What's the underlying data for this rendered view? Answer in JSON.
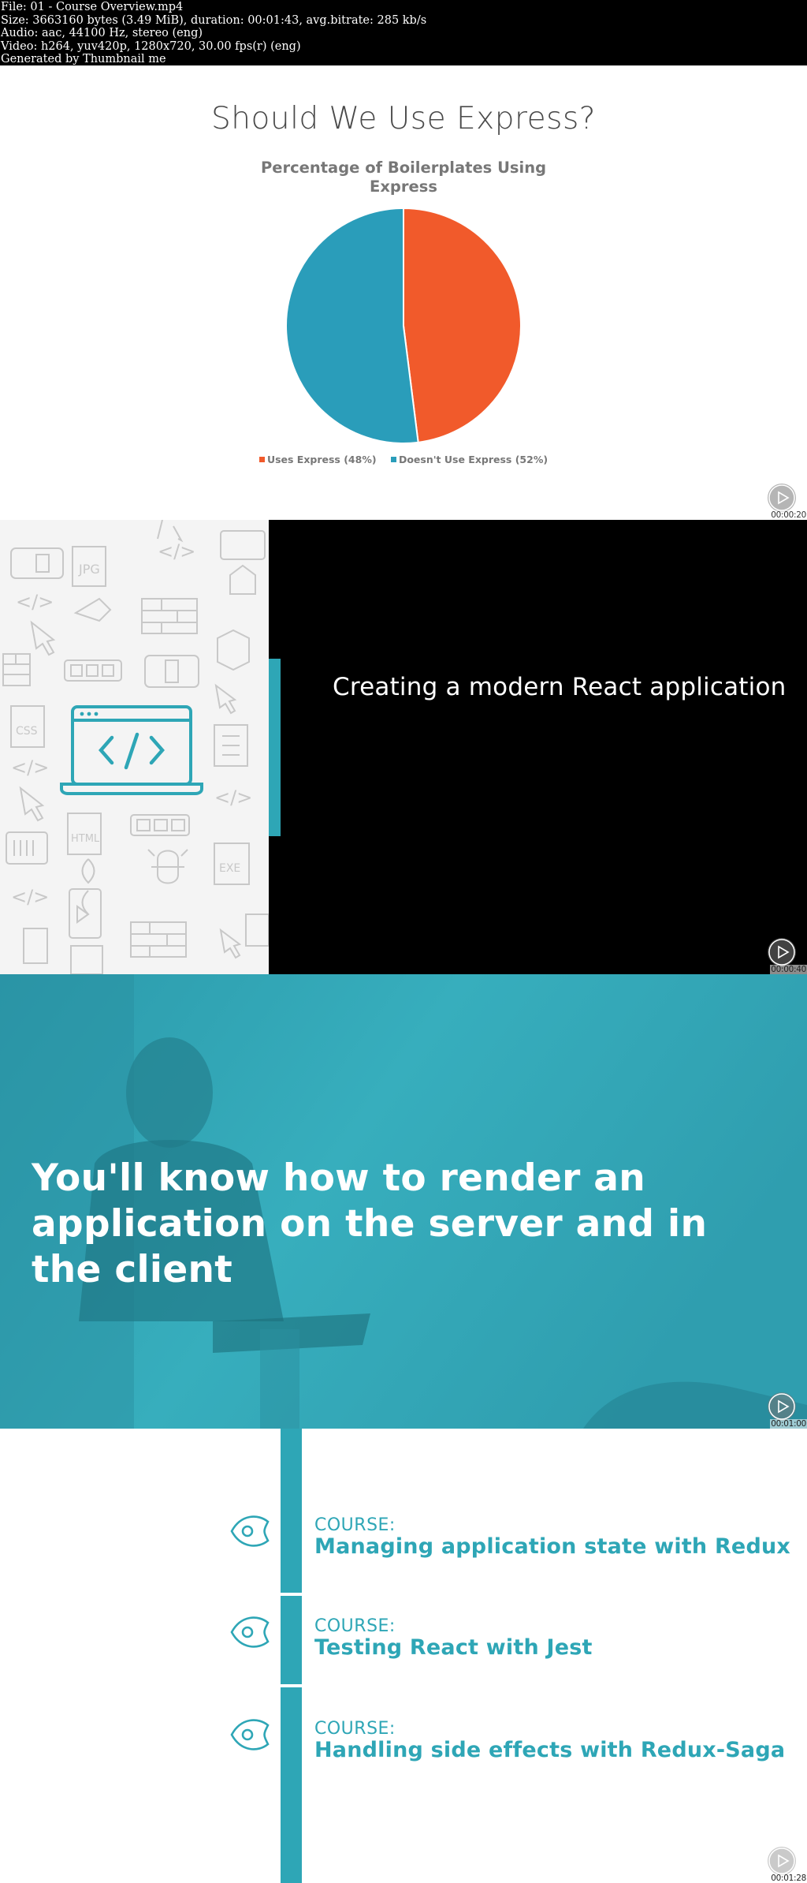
{
  "header": {
    "lines": [
      "File: 01 - Course Overview.mp4",
      "Size: 3663160 bytes (3.49 MiB), duration: 00:01:43, avg.bitrate: 285 kb/s",
      "Audio: aac, 44100 Hz, stereo (eng)",
      "Video: h264, yuv420p, 1280x720, 30.00 fps(r) (eng)",
      "Generated by Thumbnail me"
    ]
  },
  "frames": [
    {
      "timestamp": "00:00:20",
      "title": "Should We Use Express?",
      "chart_title": "Percentage of Boilerplates Using Express"
    },
    {
      "timestamp": "00:00:40",
      "heading": "Creating a modern React application"
    },
    {
      "timestamp": "00:01:00",
      "heading": "You'll know how to render an application on the server and in the client"
    },
    {
      "timestamp": "00:01:28",
      "courses": [
        {
          "kicker": "COURSE:",
          "name": "Managing application state with Redux"
        },
        {
          "kicker": "COURSE:",
          "name": "Testing React with Jest"
        },
        {
          "kicker": "COURSE:",
          "name": "Handling side effects with Redux-Saga"
        }
      ]
    }
  ],
  "chart_data": {
    "type": "pie",
    "title": "Percentage of Boilerplates Using Express",
    "categories": [
      "Uses Express (48%)",
      "Doesn't Use Express (52%)"
    ],
    "values": [
      48,
      52
    ],
    "colors": [
      "#f15a2b",
      "#2a9dba"
    ],
    "legend": "bottom"
  },
  "colors": {
    "accent": "#2ea6b6",
    "orange": "#f15a2b",
    "blue": "#2a9dba"
  },
  "icons": [
    "play-icon",
    "code-laptop-icon",
    "location-pin-icon"
  ]
}
